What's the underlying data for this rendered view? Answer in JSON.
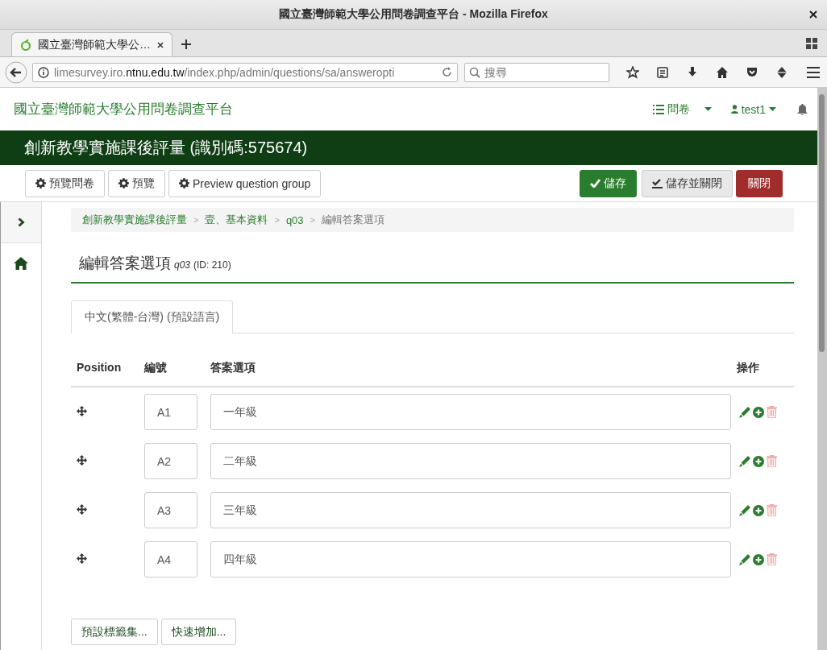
{
  "window": {
    "title": "國立臺灣師範大學公用問卷調查平台 - Mozilla Firefox"
  },
  "browser": {
    "tab_title": "國立臺灣師範大學公…",
    "url": "limesurvey.iro.**ntnu.edu.tw**/index.php/admin/questions/sa/answeropti",
    "search_placeholder": "搜尋"
  },
  "navbar": {
    "brand": "國立臺灣師範大學公用問卷調查平台",
    "menu": "問卷",
    "user": "test1"
  },
  "survey_title": "創新教學實施課後評量 (識別碼:575674)",
  "toolbar": {
    "left": [
      {
        "label": "預覽問卷"
      },
      {
        "label": "預覽"
      },
      {
        "label": "Preview question group"
      }
    ],
    "right": [
      {
        "label": "儲存",
        "kind": "save"
      },
      {
        "label": "儲存並關閉",
        "kind": "saveclose"
      },
      {
        "label": "關閉",
        "kind": "close"
      }
    ]
  },
  "breadcrumb": [
    {
      "label": "創新教學實施課後評量",
      "current": false
    },
    {
      "separator": ">",
      "label": "壹、基本資料",
      "current": false
    },
    {
      "separator": ">",
      "label": "q03",
      "current": false
    },
    {
      "separator": ">",
      "label": "編輯答案選項",
      "current": true
    }
  ],
  "heading": {
    "title": "編輯答案選項",
    "code": "q03",
    "id": "(ID: 210)"
  },
  "language_tabs": [
    {
      "label": "中文(繁體-台灣) (預設語言)",
      "selected": true
    }
  ],
  "table": {
    "columns": [
      "Position",
      "編號",
      "答案選項",
      "操作"
    ],
    "rows": [
      {
        "code": "A1",
        "answer": "一年級"
      },
      {
        "code": "A2",
        "answer": "二年級"
      },
      {
        "code": "A3",
        "answer": "三年級"
      },
      {
        "code": "A4",
        "answer": "四年級"
      }
    ]
  },
  "bottom_buttons": [
    "預設標籤集...",
    "快速增加..."
  ]
}
